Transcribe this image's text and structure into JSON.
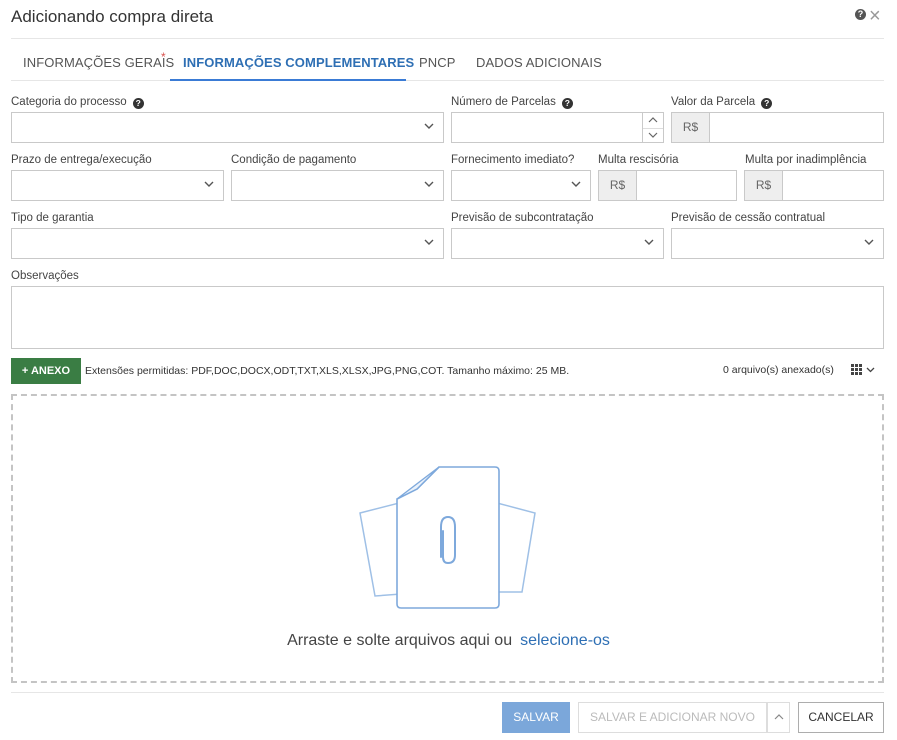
{
  "dialog": {
    "title": "Adicionando compra direta",
    "help": "?",
    "close": "×"
  },
  "tabs": [
    {
      "label": "INFORMAÇÕES GERAIS",
      "required_mark": "*"
    },
    {
      "label": "INFORMAÇÕES COMPLEMENTARES",
      "active": true
    },
    {
      "label": "PNCP"
    },
    {
      "label": "DADOS ADICIONAIS"
    }
  ],
  "form": {
    "categoria_label": "Categoria do processo",
    "categoria_value": "",
    "numero_parcelas_label": "Número de Parcelas",
    "numero_parcelas_value": "",
    "valor_parcela_label": "Valor da Parcela",
    "valor_parcela_prefix": "R$",
    "valor_parcela_value": "",
    "prazo_label": "Prazo de entrega/execução",
    "prazo_value": "",
    "condicao_label": "Condição de pagamento",
    "condicao_value": "",
    "fornecimento_label": "Fornecimento imediato?",
    "fornecimento_value": "",
    "multa_resc_label": "Multa rescisória",
    "multa_resc_prefix": "R$",
    "multa_resc_value": "",
    "multa_inad_label": "Multa por inadimplência",
    "multa_inad_prefix": "R$",
    "multa_inad_value": "",
    "garantia_label": "Tipo de garantia",
    "garantia_value": "",
    "subcontratacao_label": "Previsão de subcontratação",
    "subcontratacao_value": "",
    "cessao_label": "Previsão de cessão contratual",
    "cessao_value": "",
    "observacoes_label": "Observações",
    "observacoes_value": ""
  },
  "attachments": {
    "button_label": "+ ANEXO",
    "extensions_text": "Extensões permitidas: PDF,DOC,DOCX,ODT,TXT,XLS,XLSX,JPG,PNG,COT. Tamanho máximo: 25 MB.",
    "count_text": "0 arquivo(s) anexado(s)",
    "drop_text": "Arraste e solte arquivos aqui ou",
    "drop_link": "selecione-os"
  },
  "footer": {
    "save": "SALVAR",
    "save_add": "SALVAR E ADICIONAR NOVO",
    "cancel": "CANCELAR"
  },
  "colors": {
    "accent": "#2e6fb4",
    "anexo_button": "#3a7d44",
    "save_button": "#7ba7da",
    "required": "#d9534f"
  }
}
